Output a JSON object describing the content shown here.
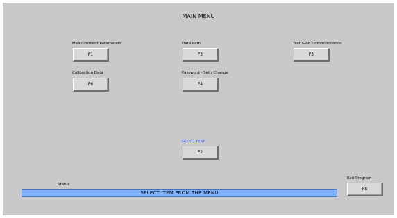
{
  "window": {
    "title": "MAIN MENU"
  },
  "menu": {
    "measurement_parameters": {
      "label": "Measurement Parameters",
      "key": "F1"
    },
    "data_path": {
      "label": "Data Path",
      "key": "F3"
    },
    "test_gpib": {
      "label": "Test GPIB Communication",
      "key": "F5"
    },
    "calibration_data": {
      "label": "Calibration Data",
      "key": "F6"
    },
    "password": {
      "label": "Password - Set / Change",
      "key": "F4"
    },
    "go_to_test": {
      "label": "GO TO TEST",
      "key": "F2",
      "label_color": "#1a3cff"
    },
    "exit_program": {
      "label": "Exit Program",
      "key": "F8"
    }
  },
  "status": {
    "label": "Status",
    "message": "SELECT ITEM FROM THE MENU",
    "bar_color": "#7fb1ff"
  },
  "colors": {
    "panel_background": "#c9c9c9",
    "button_face": "#d9d9d9"
  }
}
